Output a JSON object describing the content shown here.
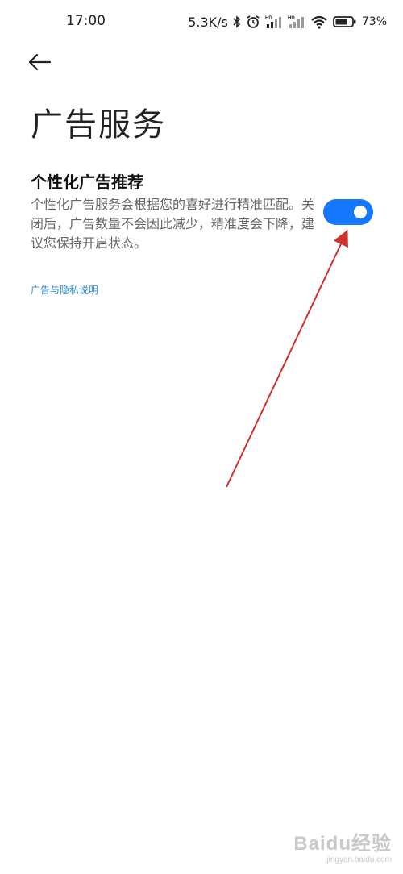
{
  "status_bar": {
    "time": "17:00",
    "net_speed": "5.3K/s",
    "signal_label": "HD",
    "battery_level": 0.73,
    "battery_text": "73%"
  },
  "page": {
    "title": "广告服务"
  },
  "setting": {
    "title": "个性化广告推荐",
    "description": "个性化广告服务会根据您的喜好进行精准匹配。关闭后，广告数量不会因此减少，精准度会下降，建议您保持开启状态。",
    "toggle_on": true
  },
  "link": {
    "privacy": "广告与隐私说明"
  },
  "watermark": {
    "logo": "Baidu经验",
    "url": "jingyan.baidu.com"
  },
  "colors": {
    "accent": "#1677ff",
    "link": "#2b8fd6",
    "annotation_arrow": "#d0312d"
  }
}
